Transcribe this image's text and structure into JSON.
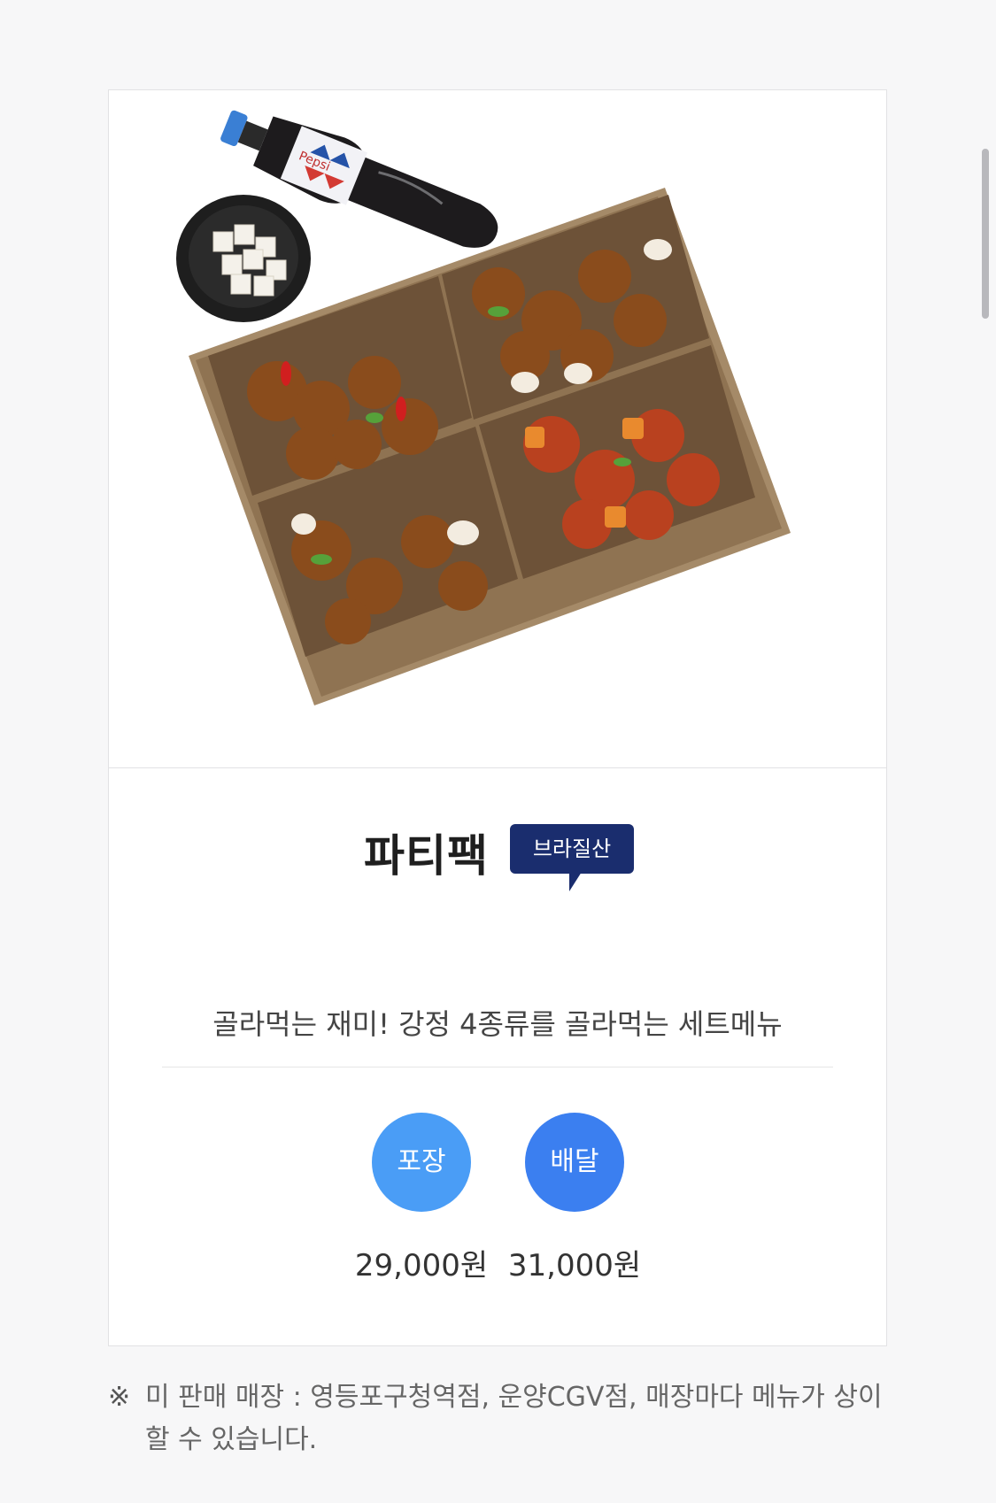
{
  "product": {
    "image_alt": "파티팩 강정 4종 세트와 콜라, 치킨무",
    "name": "파티팩",
    "badge": "브라질산",
    "description": "골라먹는 재미! 강정 4종류를 골라먹는 세트메뉴"
  },
  "order": {
    "pickup_label": "포장",
    "delivery_label": "배달",
    "pickup_price": "29,000원",
    "delivery_price": "31,000원"
  },
  "notice": {
    "mark": "※",
    "text": "미 판매 매장 : 영등포구청역점, 운양CGV점, 매장마다 메뉴가 상이할 수 있습니다."
  },
  "colors": {
    "badge": "#1a2d6e",
    "pickup": "#4a9df6",
    "delivery": "#3b7ff0"
  }
}
